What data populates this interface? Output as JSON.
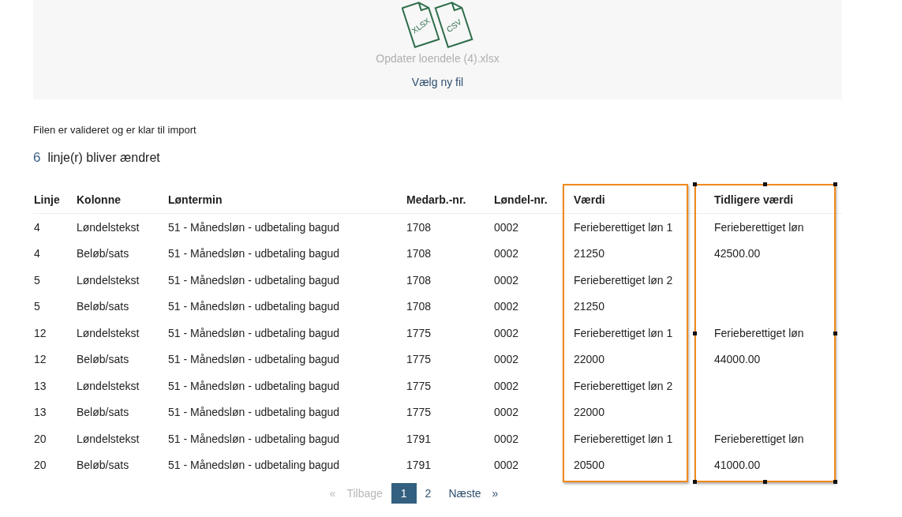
{
  "upload": {
    "file_icon_labels": [
      "XLSX",
      "CSV"
    ],
    "filename": "Opdater loendele (4).xlsx",
    "choose_link": "Vælg ny fil"
  },
  "status_message": "Filen er valideret og er klar til import",
  "summary": {
    "count": "6",
    "text": "linje(r) bliver ændret"
  },
  "table": {
    "columns": [
      {
        "label": "Linje",
        "highlighted": false,
        "selected": false
      },
      {
        "label": "Kolonne",
        "highlighted": false,
        "selected": false
      },
      {
        "label": "Løntermin",
        "highlighted": false,
        "selected": false
      },
      {
        "label": "Medarb.-nr.",
        "highlighted": false,
        "selected": false
      },
      {
        "label": "Løndel-nr.",
        "highlighted": false,
        "selected": false
      },
      {
        "label": "Værdi",
        "highlighted": true,
        "selected": false
      },
      {
        "label": "Tidligere værdi",
        "highlighted": true,
        "selected": true
      }
    ],
    "rows": [
      [
        "4",
        "Løndelstekst",
        "51 - Månedsløn - udbetaling bagud",
        "1708",
        "0002",
        "Ferieberettiget løn 1",
        "Ferieberettiget løn"
      ],
      [
        "4",
        "Beløb/sats",
        "51 - Månedsløn - udbetaling bagud",
        "1708",
        "0002",
        "21250",
        "42500.00"
      ],
      [
        "5",
        "Løndelstekst",
        "51 - Månedsløn - udbetaling bagud",
        "1708",
        "0002",
        "Ferieberettiget løn 2",
        ""
      ],
      [
        "5",
        "Beløb/sats",
        "51 - Månedsløn - udbetaling bagud",
        "1708",
        "0002",
        "21250",
        ""
      ],
      [
        "12",
        "Løndelstekst",
        "51 - Månedsløn - udbetaling bagud",
        "1775",
        "0002",
        "Ferieberettiget løn 1",
        "Ferieberettiget løn"
      ],
      [
        "12",
        "Beløb/sats",
        "51 - Månedsløn - udbetaling bagud",
        "1775",
        "0002",
        "22000",
        "44000.00"
      ],
      [
        "13",
        "Løndelstekst",
        "51 - Månedsløn - udbetaling bagud",
        "1775",
        "0002",
        "Ferieberettiget løn 2",
        ""
      ],
      [
        "13",
        "Beløb/sats",
        "51 - Månedsløn - udbetaling bagud",
        "1775",
        "0002",
        "22000",
        ""
      ],
      [
        "20",
        "Løndelstekst",
        "51 - Månedsløn - udbetaling bagud",
        "1791",
        "0002",
        "Ferieberettiget løn 1",
        "Ferieberettiget løn"
      ],
      [
        "20",
        "Beløb/sats",
        "51 - Månedsløn - udbetaling bagud",
        "1791",
        "0002",
        "20500",
        "41000.00"
      ]
    ]
  },
  "pagination": [
    {
      "kind": "prev",
      "arrow": "«",
      "label": "Tilbage",
      "disabled": true
    },
    {
      "kind": "page",
      "label": "1",
      "selected": true
    },
    {
      "kind": "page",
      "label": "2",
      "selected": false
    },
    {
      "kind": "next",
      "label": "Næste",
      "arrow": "»",
      "disabled": false
    }
  ]
}
